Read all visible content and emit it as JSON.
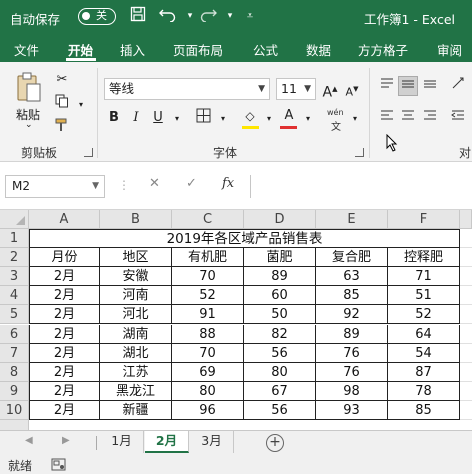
{
  "titlebar": {
    "autosave_label": "自动保存",
    "autosave_state": "关",
    "title": "工作簿1 - Excel",
    "save_icon": "save-icon",
    "undo_icon": "undo-icon",
    "redo_icon": "redo-icon"
  },
  "tabs": [
    "文件",
    "开始",
    "插入",
    "页面布局",
    "公式",
    "数据",
    "方方格子",
    "审阅"
  ],
  "active_tab": "开始",
  "ribbon": {
    "clipboard": {
      "paste": "粘贴",
      "group": "剪贴板"
    },
    "font": {
      "name": "等线",
      "size": "11",
      "bold": "B",
      "italic": "I",
      "underline": "U",
      "font_color_letter": "A",
      "phonetic": "wén",
      "group": "字体"
    },
    "alignment_group_partial": "对"
  },
  "formula_bar": {
    "name_box": "M2",
    "cancel_glyph": "✕",
    "enter_glyph": "✓",
    "fx": "fx",
    "content": ""
  },
  "grid": {
    "columns": [
      "A",
      "B",
      "C",
      "D",
      "E",
      "F"
    ],
    "rows": [
      "1",
      "2",
      "3",
      "4",
      "5",
      "6",
      "7",
      "8",
      "9",
      "10"
    ],
    "title": "2019年各区域产品销售表",
    "headers": [
      "月份",
      "地区",
      "有机肥",
      "菌肥",
      "复合肥",
      "控释肥"
    ],
    "data": [
      [
        "2月",
        "安徽",
        "70",
        "89",
        "63",
        "71"
      ],
      [
        "2月",
        "河南",
        "52",
        "60",
        "85",
        "51"
      ],
      [
        "2月",
        "河北",
        "91",
        "50",
        "92",
        "52"
      ],
      [
        "2月",
        "湖南",
        "88",
        "82",
        "89",
        "64"
      ],
      [
        "2月",
        "湖北",
        "70",
        "56",
        "76",
        "54"
      ],
      [
        "2月",
        "江苏",
        "69",
        "80",
        "76",
        "87"
      ],
      [
        "2月",
        "黑龙江",
        "80",
        "67",
        "98",
        "78"
      ],
      [
        "2月",
        "新疆",
        "96",
        "56",
        "93",
        "85"
      ]
    ]
  },
  "sheet_tabs": [
    "1月",
    "2月",
    "3月"
  ],
  "active_sheet": "2月",
  "add_sheet_glyph": "+",
  "status": {
    "ready": "就绪"
  },
  "colors": {
    "accent": "#217346",
    "highlight_yellow": "#ffe600",
    "font_red": "#e03030"
  }
}
